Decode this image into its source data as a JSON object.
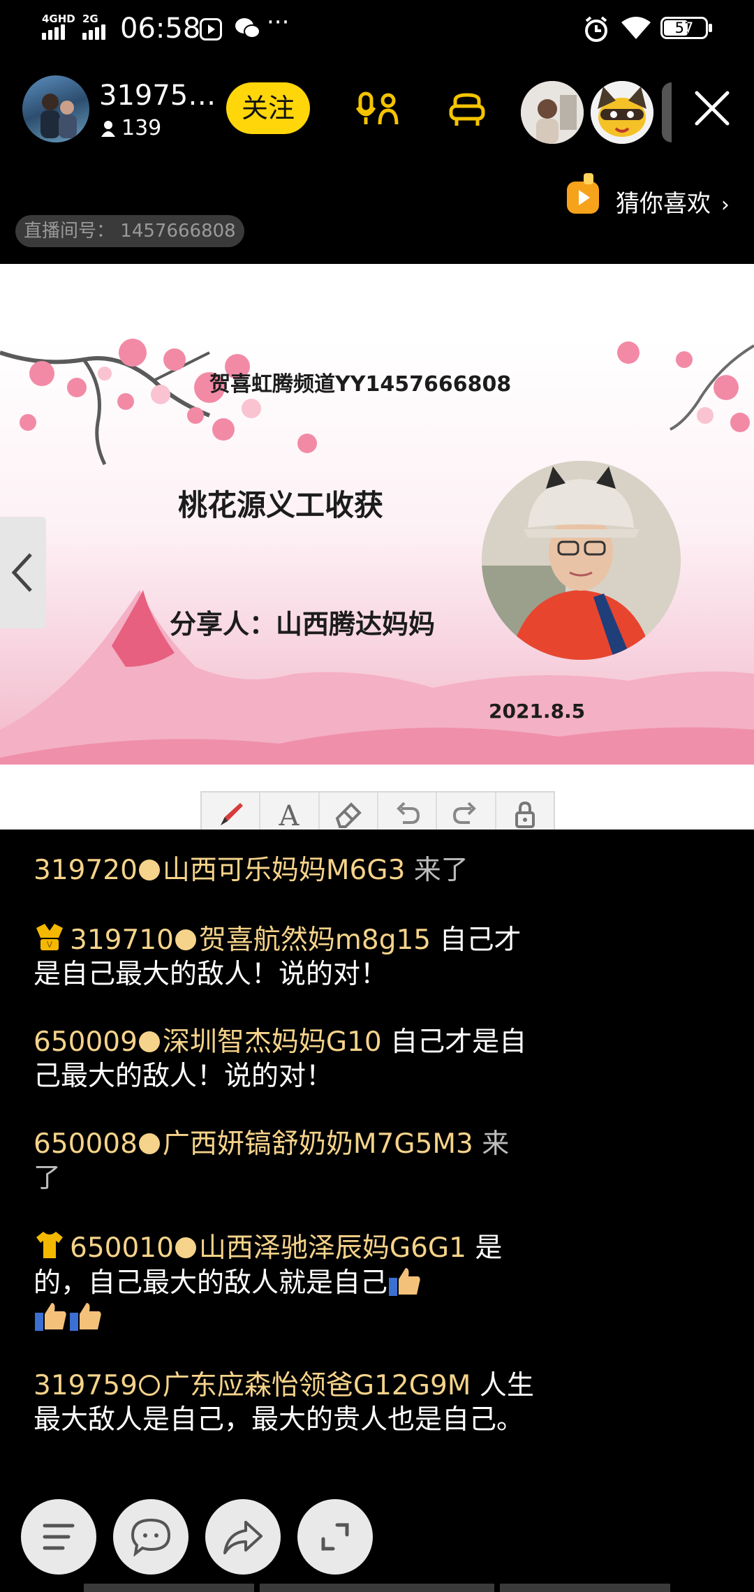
{
  "status_bar": {
    "net1": "4GHD",
    "net2": "2G",
    "time": "06:58",
    "more": "···",
    "battery": "57"
  },
  "header": {
    "host_name": "31975…",
    "viewer_count": "139",
    "follow_label": "关注",
    "recommend_label": "猜你喜欢",
    "room_id_label": "直播间号：",
    "room_id": "1457666808"
  },
  "slide": {
    "channel": "贺喜虹腾频道YY1457666808",
    "title": "桃花源义工收获",
    "sharer": "分享人：山西腾达妈妈",
    "date": "2021.8.5"
  },
  "chat": {
    "messages": [
      {
        "uid": "319720",
        "dot": "filled",
        "nick": "山西可乐妈妈M6G3",
        "action": "来了",
        "text": ""
      },
      {
        "uid": "319710",
        "dot": "filled",
        "nick": "贺喜航然妈m8g15",
        "action": "",
        "text": "自己才是自己最大的敌人！说的对！"
      },
      {
        "uid": "650009",
        "dot": "filled",
        "nick": "深圳智杰妈妈G10",
        "action": "",
        "text": "自己才是自己最大的敌人！说的对！"
      },
      {
        "uid": "650008",
        "dot": "filled",
        "nick": "广西妍镐舒奶奶M7G5M3",
        "action": "来了",
        "text": ""
      },
      {
        "uid": "650010",
        "dot": "filled",
        "nick": "山西泽驰泽辰妈G6G1",
        "action": "",
        "text": "是的，自己最大的敌人就是自己"
      },
      {
        "uid": "319759",
        "dot": "hollow",
        "nick": "广东应森怡领爸G12G9M",
        "action": "",
        "text": "人生最大敌人是自己，最大的贵人也是自己。"
      }
    ]
  },
  "colors": {
    "follow_bg": "#ffd60a",
    "accent_yellow": "#f6d38a",
    "icon_yellow": "#f5c400"
  }
}
